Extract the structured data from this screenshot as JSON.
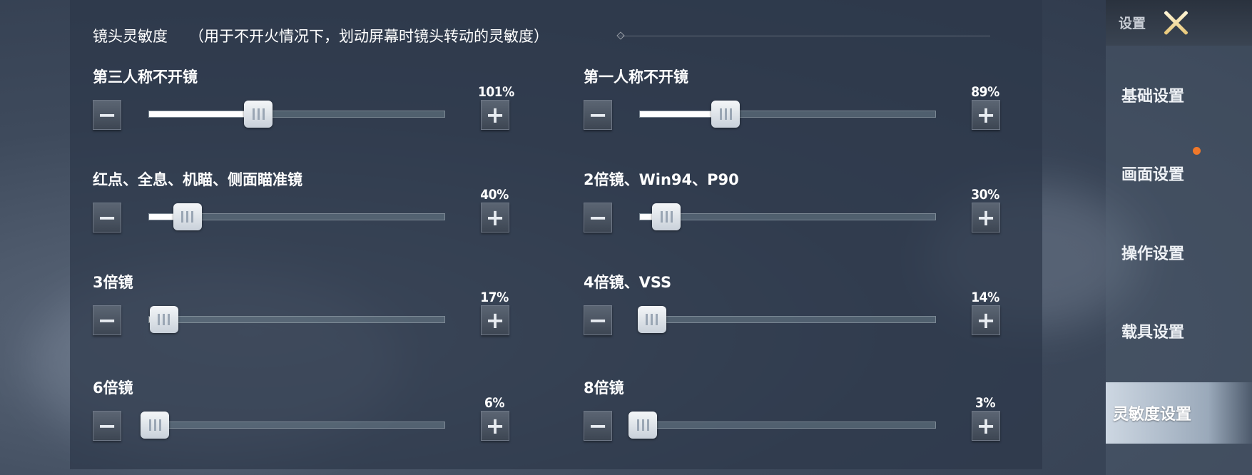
{
  "header": {
    "title": "镜头灵敏度",
    "note": "（用于不开火情况下，划动屏幕时镜头转动的灵敏度）"
  },
  "settings": [
    {
      "label": "第三人称不开镜",
      "value": "101%",
      "fraction": 0.37
    },
    {
      "label": "第一人称不开镜",
      "value": "89%",
      "fraction": 0.29
    },
    {
      "label": "红点、全息、机瞄、侧面瞄准镜",
      "value": "40%",
      "fraction": 0.13
    },
    {
      "label": "2倍镜、Win94、P90",
      "value": "30%",
      "fraction": 0.09
    },
    {
      "label": "3倍镜",
      "value": "17%",
      "fraction": 0.05
    },
    {
      "label": "4倍镜、VSS",
      "value": "14%",
      "fraction": 0.04
    },
    {
      "label": "6倍镜",
      "value": "6%",
      "fraction": 0.02
    },
    {
      "label": "8倍镜",
      "value": "3%",
      "fraction": 0.01
    }
  ],
  "buttons": {
    "minus": "−",
    "plus": "+"
  },
  "sidebar": {
    "top_label": "设置",
    "items": [
      {
        "label": "基础设置"
      },
      {
        "label": "画面设置",
        "has_notification": true
      },
      {
        "label": "操作设置"
      },
      {
        "label": "载具设置"
      },
      {
        "label": "灵敏度设置",
        "active": true
      }
    ]
  },
  "colors": {
    "notification_dot": "#f0782a",
    "slider_fill": "#ffffff",
    "close_icon": "#e8c777"
  }
}
